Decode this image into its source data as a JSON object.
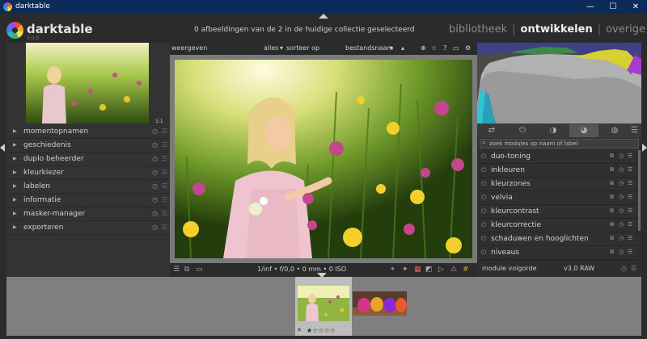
{
  "window": {
    "title": "darktable",
    "minimize": "—",
    "maximize": "☐",
    "close": "✕"
  },
  "header": {
    "brand": "darktable",
    "version": "3.0.0",
    "status": "0 afbeeldingen van de 2 in de huidige collectie geselecteerd",
    "views": [
      "bibliotheek",
      "ontwikkelen",
      "overige"
    ],
    "active_view": "ontwikkelen"
  },
  "left_panel": {
    "zoom_label": "1:1",
    "modules": [
      "momentopnamen",
      "geschiedenis",
      "duplo beheerder",
      "kleurkiezer",
      "labelen",
      "informatie",
      "masker-manager",
      "exporteren"
    ]
  },
  "center": {
    "toolbar": {
      "view_label": "weergeven",
      "filter_value": "alles",
      "sort_label": "sorteer op",
      "sort_value": "bestandsnaam"
    },
    "exif": "1/inf • f/0,0 • 0 mm • 0 ISO"
  },
  "right_panel": {
    "search_placeholder": "zoek modules op naam of label",
    "modules": [
      "duo-toning",
      "inkleuren",
      "kleurzones",
      "velvia",
      "kleurcontrast",
      "kleurcorrectie",
      "schaduwen en hooglichten",
      "niveaus"
    ],
    "footer_label": "module volgorde",
    "footer_value": "v3.0 RAW"
  },
  "filmstrip": {
    "stars": "★☆☆☆☆",
    "reject": "✕"
  },
  "colors": {
    "accent_tab": "#555555",
    "panel_bg": "#333333",
    "filmstrip_bg": "#7f7f7f"
  }
}
